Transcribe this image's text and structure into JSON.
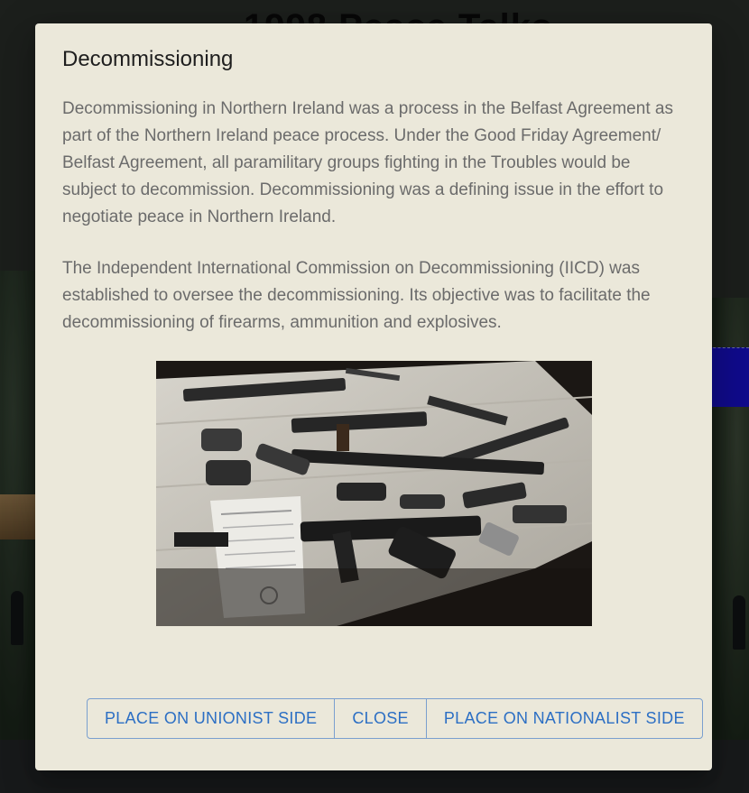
{
  "background": {
    "title": "1998 Peace Talks"
  },
  "dialog": {
    "title": "Decommissioning",
    "paragraphs": [
      "Decommissioning in Northern Ireland was a process in the Belfast Agreement as part of the Northern Ireland peace process. Under the Good Friday Agreement/ Belfast Agreement, all paramilitary groups fighting in the Troubles would be subject to decommission. Decommissioning was a defining issue in the effort to negotiate peace in Northern Ireland.",
      "The Independent International Commission on Decommissioning (IICD) was established to oversee the decommissioning. Its objective was to facilitate the decommissioning of firearms, ammunition and explosives."
    ],
    "image": {
      "subject": "decommissioned-firearms-photo"
    },
    "buttons": {
      "unionist": "PLACE ON UNIONIST SIDE",
      "close": "CLOSE",
      "nationalist": "PLACE ON NATIONALIST SIDE"
    }
  },
  "colors": {
    "dialog_bg": "#ebe8da",
    "button_text": "#2c6fc4",
    "button_border": "#7a9fcf",
    "body_text": "#6b6b6b"
  }
}
